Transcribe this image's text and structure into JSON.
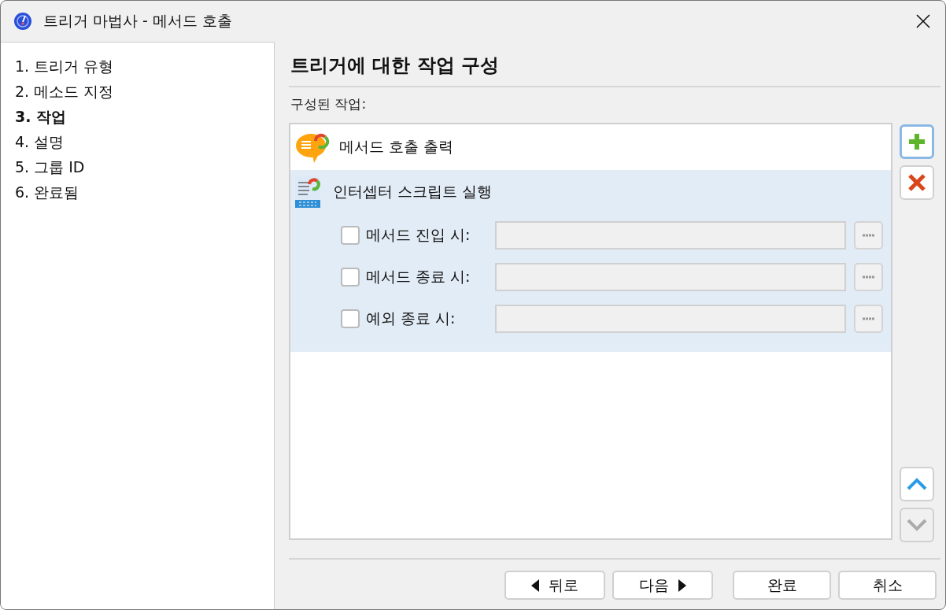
{
  "window": {
    "title": "트리거 마법사 - 메서드 호출"
  },
  "steps": [
    {
      "label": "1. 트리거 유형",
      "selected": false
    },
    {
      "label": "2. 메소드 지정",
      "selected": false
    },
    {
      "label": "3. 작업",
      "selected": true
    },
    {
      "label": "4. 설명",
      "selected": false
    },
    {
      "label": "5. 그룹 ID",
      "selected": false
    },
    {
      "label": "6. 완료됨",
      "selected": false
    }
  ],
  "heading": "트리거에 대한 작업 구성",
  "actions_label": "구성된 작업:",
  "actions": [
    {
      "kind": "output",
      "label": "메서드 호출 출력",
      "selected": false
    },
    {
      "kind": "script",
      "label": "인터셉터 스크립트 실행",
      "selected": true,
      "options": [
        {
          "label": "메서드 진입 시:",
          "checked": false,
          "disabled": true
        },
        {
          "label": "메서드 종료 시:",
          "checked": false,
          "disabled": true
        },
        {
          "label": "예외 종료 시:",
          "checked": false,
          "disabled": true
        }
      ]
    }
  ],
  "side_buttons": [
    {
      "kind": "add",
      "disabled": false,
      "focused": true
    },
    {
      "kind": "delete",
      "disabled": false,
      "focused": false
    },
    {
      "kind": "up",
      "disabled": false,
      "focused": false
    },
    {
      "kind": "down",
      "disabled": true,
      "focused": false
    }
  ],
  "buttons": [
    {
      "kind": "back",
      "label": "뒤로"
    },
    {
      "kind": "next",
      "label": "다음"
    },
    {
      "kind": "finish",
      "label": "완료"
    },
    {
      "kind": "cancel",
      "label": "취소"
    }
  ]
}
